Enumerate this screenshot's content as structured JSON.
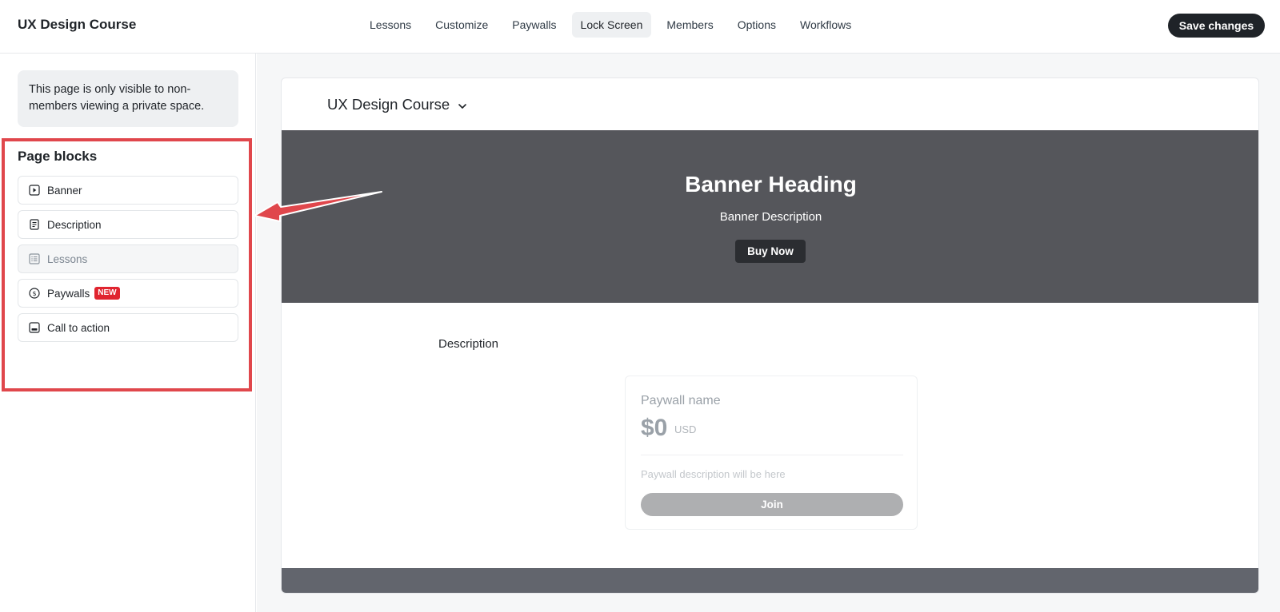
{
  "header": {
    "app_title": "UX Design Course",
    "tabs": [
      {
        "label": "Lessons",
        "active": false
      },
      {
        "label": "Customize",
        "active": false
      },
      {
        "label": "Paywalls",
        "active": false
      },
      {
        "label": "Lock Screen",
        "active": true
      },
      {
        "label": "Members",
        "active": false
      },
      {
        "label": "Options",
        "active": false
      },
      {
        "label": "Workflows",
        "active": false
      }
    ],
    "save_label": "Save changes"
  },
  "sidebar": {
    "notice": "This page is only visible to non-members viewing a private space.",
    "blocks_title": "Page blocks",
    "blocks": [
      {
        "label": "Banner",
        "icon": "play-square-icon",
        "disabled": false
      },
      {
        "label": "Description",
        "icon": "document-icon",
        "disabled": false
      },
      {
        "label": "Lessons",
        "icon": "list-icon",
        "disabled": true
      },
      {
        "label": "Paywalls",
        "icon": "dollar-circle-icon",
        "disabled": false,
        "badge": "NEW"
      },
      {
        "label": "Call to action",
        "icon": "cta-icon",
        "disabled": false
      }
    ]
  },
  "preview": {
    "course_name": "UX Design Course",
    "banner": {
      "heading": "Banner Heading",
      "description": "Banner Description",
      "button": "Buy Now"
    },
    "description_label": "Description",
    "paywall": {
      "name": "Paywall name",
      "price": "$0",
      "currency": "USD",
      "description": "Paywall description will be here",
      "button": "Join"
    }
  },
  "colors": {
    "highlight_border": "#e0474c",
    "banner_bg": "#55565b",
    "badge_new": "#e0242f",
    "dark_button": "#1f2328"
  }
}
